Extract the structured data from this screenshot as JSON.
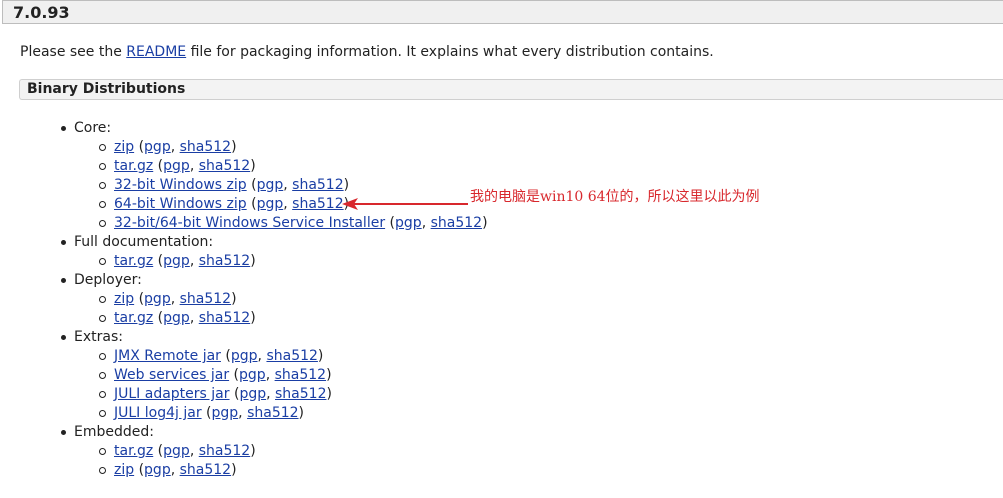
{
  "version": "7.0.93",
  "intro": {
    "before": "Please see the ",
    "link": "README",
    "after": " file for packaging information. It explains what every distribution contains."
  },
  "section_title": "Binary Distributions",
  "groups": [
    {
      "label": "Core:",
      "items": [
        {
          "link": "zip",
          "pgp": "pgp",
          "sha": "sha512"
        },
        {
          "link": "tar.gz",
          "pgp": "pgp",
          "sha": "sha512"
        },
        {
          "link": "32-bit Windows zip",
          "pgp": "pgp",
          "sha": "sha512"
        },
        {
          "link": "64-bit Windows zip",
          "pgp": "pgp",
          "sha": "sha512"
        },
        {
          "link": "32-bit/64-bit Windows Service Installer",
          "pgp": "pgp",
          "sha": "sha512"
        }
      ]
    },
    {
      "label": "Full documentation:",
      "items": [
        {
          "link": "tar.gz",
          "pgp": "pgp",
          "sha": "sha512"
        }
      ]
    },
    {
      "label": "Deployer:",
      "items": [
        {
          "link": "zip",
          "pgp": "pgp",
          "sha": "sha512"
        },
        {
          "link": "tar.gz",
          "pgp": "pgp",
          "sha": "sha512"
        }
      ]
    },
    {
      "label": "Extras:",
      "items": [
        {
          "link": "JMX Remote jar",
          "pgp": "pgp",
          "sha": "sha512"
        },
        {
          "link": "Web services jar",
          "pgp": "pgp",
          "sha": "sha512"
        },
        {
          "link": "JULI adapters jar",
          "pgp": "pgp",
          "sha": "sha512"
        },
        {
          "link": "JULI log4j jar",
          "pgp": "pgp",
          "sha": "sha512"
        }
      ]
    },
    {
      "label": "Embedded:",
      "items": [
        {
          "link": "tar.gz",
          "pgp": "pgp",
          "sha": "sha512"
        },
        {
          "link": "zip",
          "pgp": "pgp",
          "sha": "sha512"
        }
      ]
    }
  ],
  "annotation": {
    "text": "我的电脑是win10 64位的，所以这里以此为例",
    "color": "#d8282d"
  },
  "colors": {
    "link": "#1a3ea4",
    "header_bg": "#f0f0f0"
  }
}
